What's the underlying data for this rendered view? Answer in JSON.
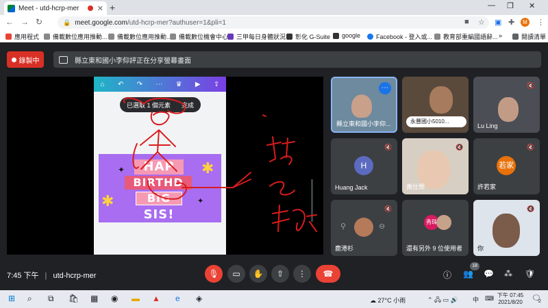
{
  "browser": {
    "tab_title": "Meet - utd-hcrp-mer",
    "tab_close": "✕",
    "new_tab": "+",
    "url_host": "meet.google.com",
    "url_path": "/utd-hcrp-mer?authuser=1&pli=1",
    "profile_initial": "M"
  },
  "bookmarks": [
    {
      "label": "應用程式",
      "color": "#ea4335"
    },
    {
      "label": "備載數位應用推動...",
      "color": "#888"
    },
    {
      "label": "備載數位應用推動...",
      "color": "#888"
    },
    {
      "label": "備載數位機會中心",
      "color": "#888"
    },
    {
      "label": "三甲每日身體狀況",
      "color": "#673ab7"
    },
    {
      "label": "彰化 G-Suite",
      "color": "#333"
    },
    {
      "label": "google",
      "color": "#333"
    },
    {
      "label": "Facebook - 登入或...",
      "color": "#1877f2"
    },
    {
      "label": "教育部重編國語辭...",
      "color": "#888"
    },
    {
      "label": "»",
      "color": ""
    },
    {
      "label": "閱讀清單",
      "color": "#5f6368"
    }
  ],
  "meet": {
    "recording_label": "錄製中",
    "presenter_banner": "縣立東和國小李仰評正在分享螢幕畫面",
    "time": "7:45 下午",
    "meeting_code": "utd-hcrp-mer",
    "participant_count": "18"
  },
  "canva": {
    "selection_text": "已選取 1 個元素",
    "done_label": "完成",
    "card_words": [
      "HAP",
      "BIRTHD",
      "BIG",
      "SIS!"
    ]
  },
  "tiles": [
    {
      "name": "縣立東和國小李仰...",
      "type": "video"
    },
    {
      "name": "永豐國小5010...",
      "type": "video"
    },
    {
      "name": "Lu Ling",
      "type": "video"
    },
    {
      "name": "Huang Jack",
      "type": "avatar",
      "initial": "H",
      "color": "#5c6bc0"
    },
    {
      "name": "黃仕閔",
      "type": "video"
    },
    {
      "name": "許若家",
      "type": "avatar",
      "initial": "若家",
      "color": "#e8710a"
    },
    {
      "name": "鹿港杉",
      "type": "video"
    },
    {
      "name": "還有另外 9 位使用者",
      "type": "others",
      "badge": "秀珠"
    },
    {
      "name": "你",
      "type": "video"
    }
  ],
  "taskbar": {
    "weather": "27°C 小雨",
    "ime": "中",
    "time": "下午 07:45",
    "date": "2021/8/20",
    "notif": "2"
  }
}
